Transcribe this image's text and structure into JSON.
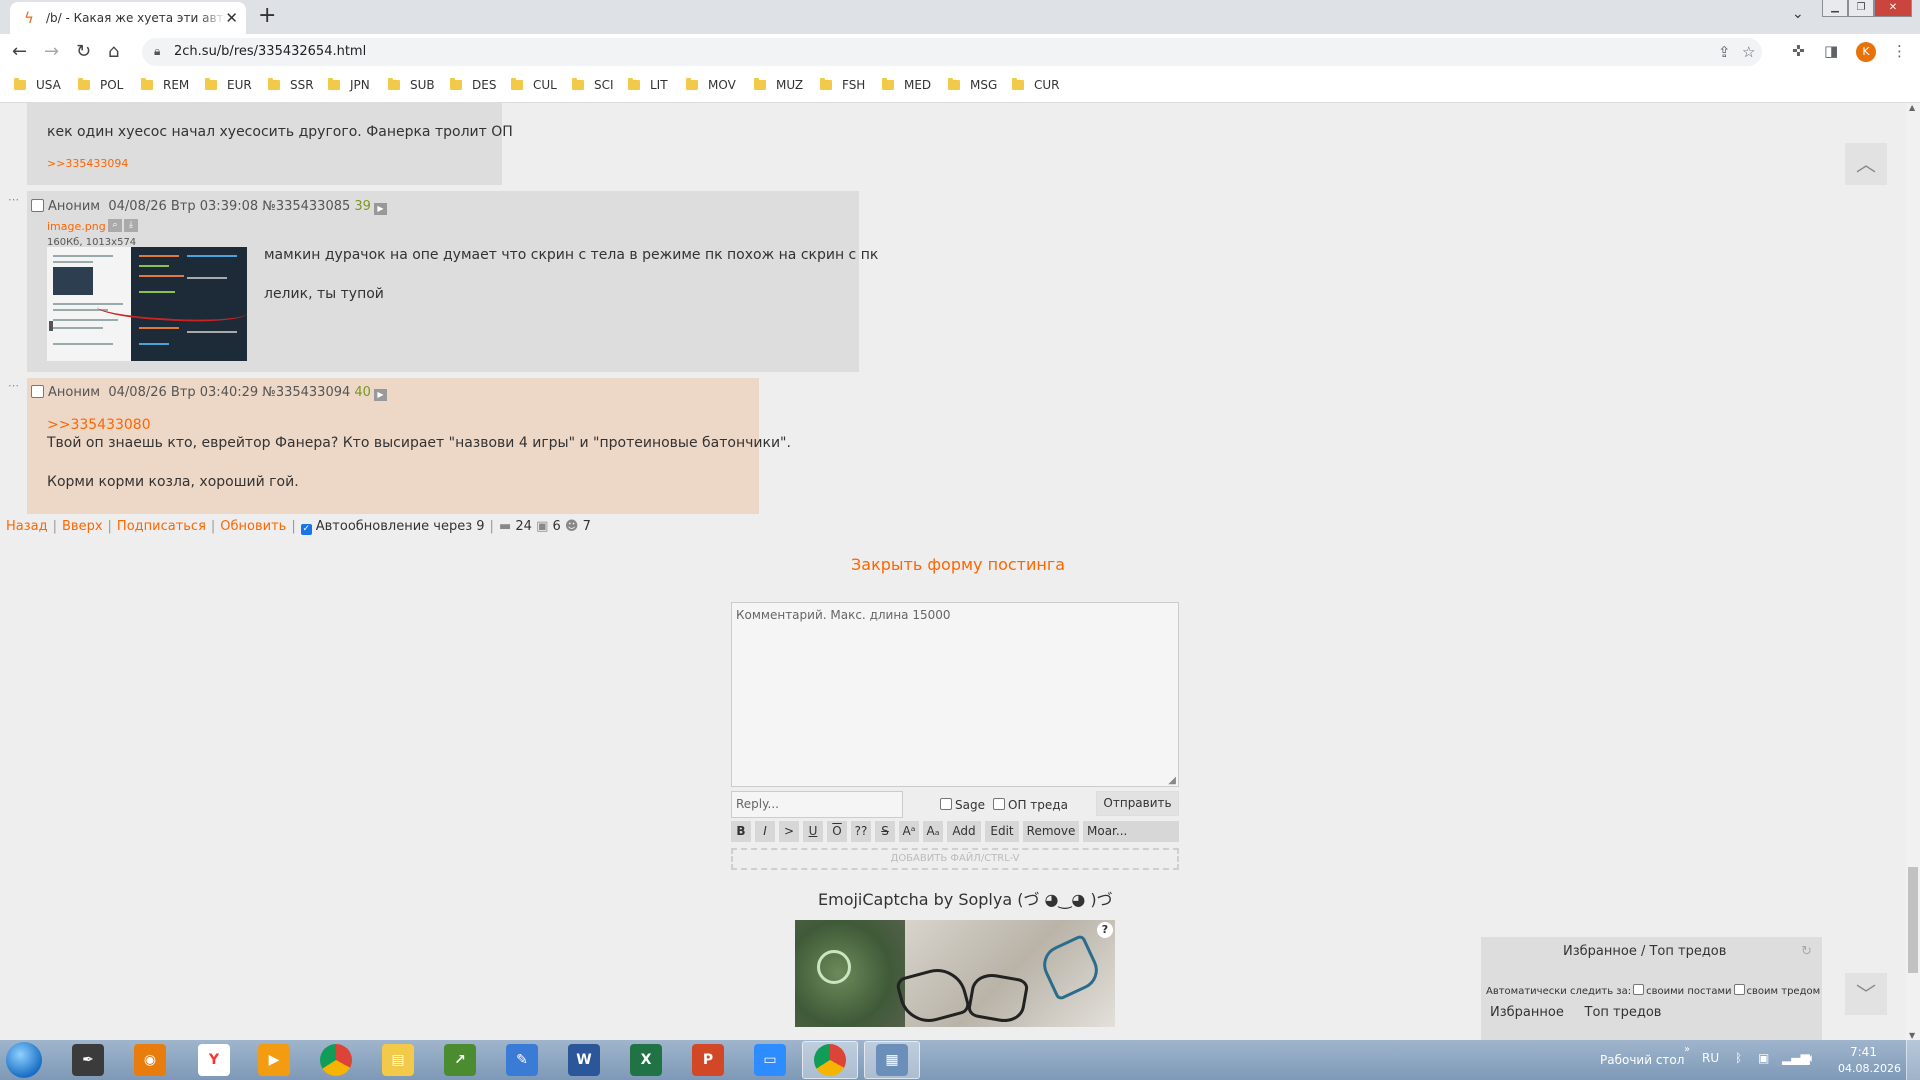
{
  "browser": {
    "tab_title": "/b/ - Какая же хуета эти автономные",
    "url": "2ch.su/b/res/335432654.html",
    "bookmarks": [
      "USA",
      "POL",
      "REM",
      "EUR",
      "SSR",
      "JPN",
      "SUB",
      "DES",
      "CUL",
      "SCI",
      "LIT",
      "MOV",
      "MUZ",
      "FSH",
      "MED",
      "MSG",
      "CUR"
    ],
    "profile_letter": "K"
  },
  "posts": {
    "prev_text": "кек один хуесос начал хуесосить другого. Фанерка тролит ОП",
    "prev_reply": ">>335433094",
    "p1": {
      "name": "Аноним",
      "date": "04/08/26 Втр 03:39:08",
      "num": "№335433085",
      "count": "39",
      "file_name": "image.png",
      "file_meta": "160Кб, 1013x574",
      "line1": "мамкин дурачок на опе думает что скрин с тела в режиме пк похож на скрин с пк",
      "line2": "лелик, ты тупой"
    },
    "p2": {
      "name": "Аноним",
      "date": "04/08/26 Втр 03:40:29",
      "num": "№335433094",
      "count": "40",
      "quote": ">>335433080",
      "line1": "Твой оп знаешь кто, еврейтор Фанера? Кто высирает \"назвови 4 игры\" и \"протеиновые батончики\".",
      "line2": "Корми корми козла, хороший гой."
    }
  },
  "thread_nav": {
    "back": "Назад",
    "up": "Вверх",
    "subscribe": "Подписаться",
    "refresh": "Обновить",
    "autoupdate": "Автообновление через 9",
    "posts_count": "24",
    "images_count": "6",
    "users_count": "7"
  },
  "form": {
    "close_label": "Закрыть форму постинга",
    "comment_placeholder": "Комментарий. Макс. длина 15000",
    "reply_placeholder": "Reply...",
    "sage_label": "Sage",
    "op_label": "ОП треда",
    "send_label": "Отправить",
    "markup": [
      "B",
      "I",
      ">",
      "U",
      "O",
      "??",
      "S",
      "Aᵃ",
      "Aₐ"
    ],
    "add_label": "Add",
    "edit_label": "Edit",
    "remove_label": "Remove",
    "moar_label": "Moar...",
    "drop_label": "ДОБАВИТЬ ФАЙЛ/CTRL-V",
    "captcha_title": "EmojiCaptcha by Soplya (づ ◕‿◕ )づ",
    "captcha_help": "?"
  },
  "favorites": {
    "title": "Избранное / Топ тредов",
    "auto_label": "Автоматически следить за:",
    "own_posts": "своими постами",
    "own_thread": "своим тредом",
    "tab_fav": "Избранное",
    "tab_top": "Топ тредов"
  },
  "taskbar": {
    "desktop_label": "Рабочий стол",
    "lang": "RU",
    "time": "7:41",
    "date": "04.08.2026"
  },
  "colors": {
    "accent": "#ff6600",
    "post_bg": "#dddddd",
    "op_post_bg": "#edd7c7",
    "page_bg": "#eeeeee"
  }
}
